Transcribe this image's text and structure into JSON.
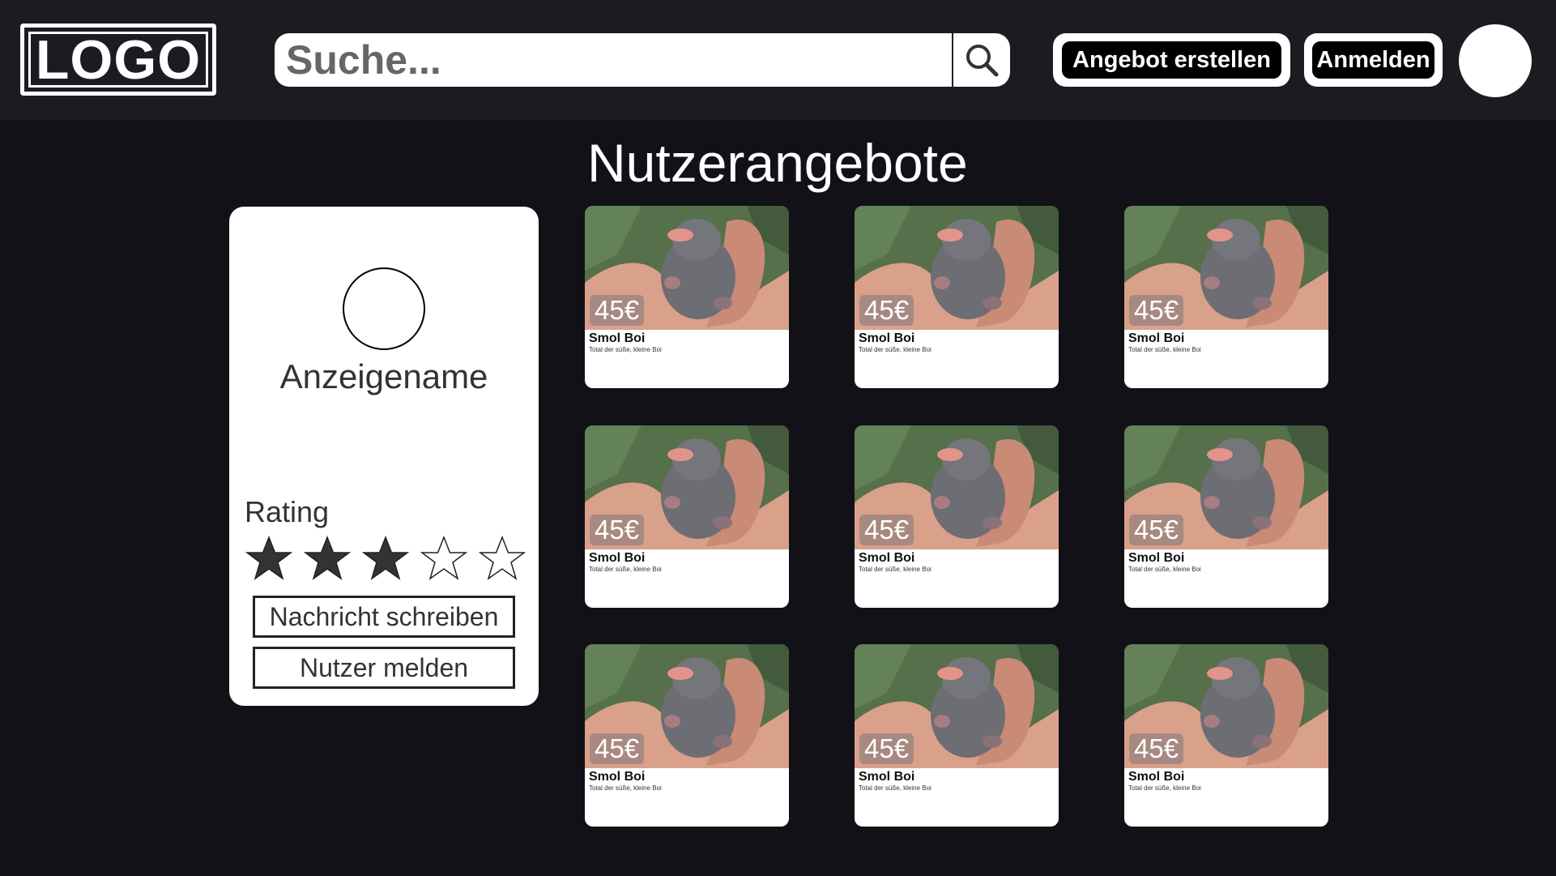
{
  "header": {
    "logo_text": "LOGO",
    "search_placeholder": "Suche...",
    "create_offer_label": "Angebot erstellen",
    "login_label": "Anmelden"
  },
  "page_title": "Nutzerangebote",
  "profile": {
    "display_name": "Anzeigename",
    "rating_label": "Rating",
    "rating": 3,
    "rating_max": 5,
    "message_label": "Nachricht schreiben",
    "report_label": "Nutzer melden"
  },
  "offers": [
    {
      "price": "45€",
      "title": "Smol Boi",
      "description": "Total der süße, kleine Boi"
    },
    {
      "price": "45€",
      "title": "Smol Boi",
      "description": "Total der süße, kleine Boi"
    },
    {
      "price": "45€",
      "title": "Smol Boi",
      "description": "Total der süße, kleine Boi"
    },
    {
      "price": "45€",
      "title": "Smol Boi",
      "description": "Total der süße, kleine Boi"
    },
    {
      "price": "45€",
      "title": "Smol Boi",
      "description": "Total der süße, kleine Boi"
    },
    {
      "price": "45€",
      "title": "Smol Boi",
      "description": "Total der süße, kleine Boi"
    },
    {
      "price": "45€",
      "title": "Smol Boi",
      "description": "Total der süße, kleine Boi"
    },
    {
      "price": "45€",
      "title": "Smol Boi",
      "description": "Total der süße, kleine Boi"
    },
    {
      "price": "45€",
      "title": "Smol Boi",
      "description": "Total der süße, kleine Boi"
    }
  ],
  "colors": {
    "background": "#121117",
    "header": "#1c1b22",
    "star_filled": "#333333"
  },
  "icons": {
    "search": "search-icon",
    "star": "star-icon"
  }
}
